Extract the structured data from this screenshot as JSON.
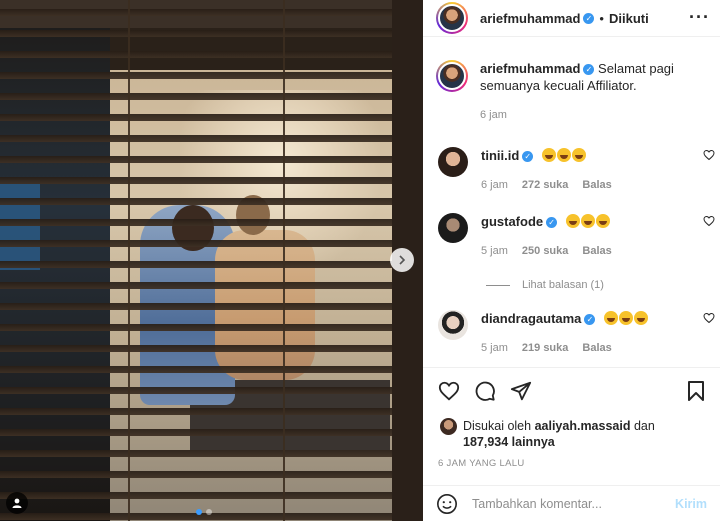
{
  "post": {
    "author": "ariefmuhammad",
    "follow_state": "Diikuti",
    "carousel": {
      "total": 2,
      "active_index": 0
    }
  },
  "caption": {
    "username": "ariefmuhammad",
    "text": "Selamat pagi semuanya kecuali Affiliator.",
    "time": "6 jam"
  },
  "comments": [
    {
      "username": "tinii.id",
      "verified": true,
      "emoji_count": 3,
      "time": "6 jam",
      "likes": "272 suka",
      "reply": "Balas",
      "avatar_color": "#3b2a22"
    },
    {
      "username": "gustafode",
      "verified": true,
      "emoji_count": 3,
      "time": "5 jam",
      "likes": "250 suka",
      "reply": "Balas",
      "avatar_color": "#1f1f1f"
    },
    {
      "username": "diandragautama",
      "verified": true,
      "emoji_count": 3,
      "time": "5 jam",
      "likes": "219 suka",
      "reply": "Balas",
      "avatar_color": "#bfb6ae"
    }
  ],
  "view_replies": "Lihat balasan (1)",
  "likes": {
    "prefix": "Disukai oleh",
    "user": "aaliyah.massaid",
    "conjunction": "dan",
    "others": "187,934 lainnya"
  },
  "timestamp": "6 JAM YANG LALU",
  "add_comment": {
    "placeholder": "Tambahkan komentar...",
    "post_label": "Kirim"
  },
  "colors": {
    "verified": "#3897f0",
    "link_disabled": "#b2dffc",
    "secondary_text": "#8e8e8e"
  }
}
